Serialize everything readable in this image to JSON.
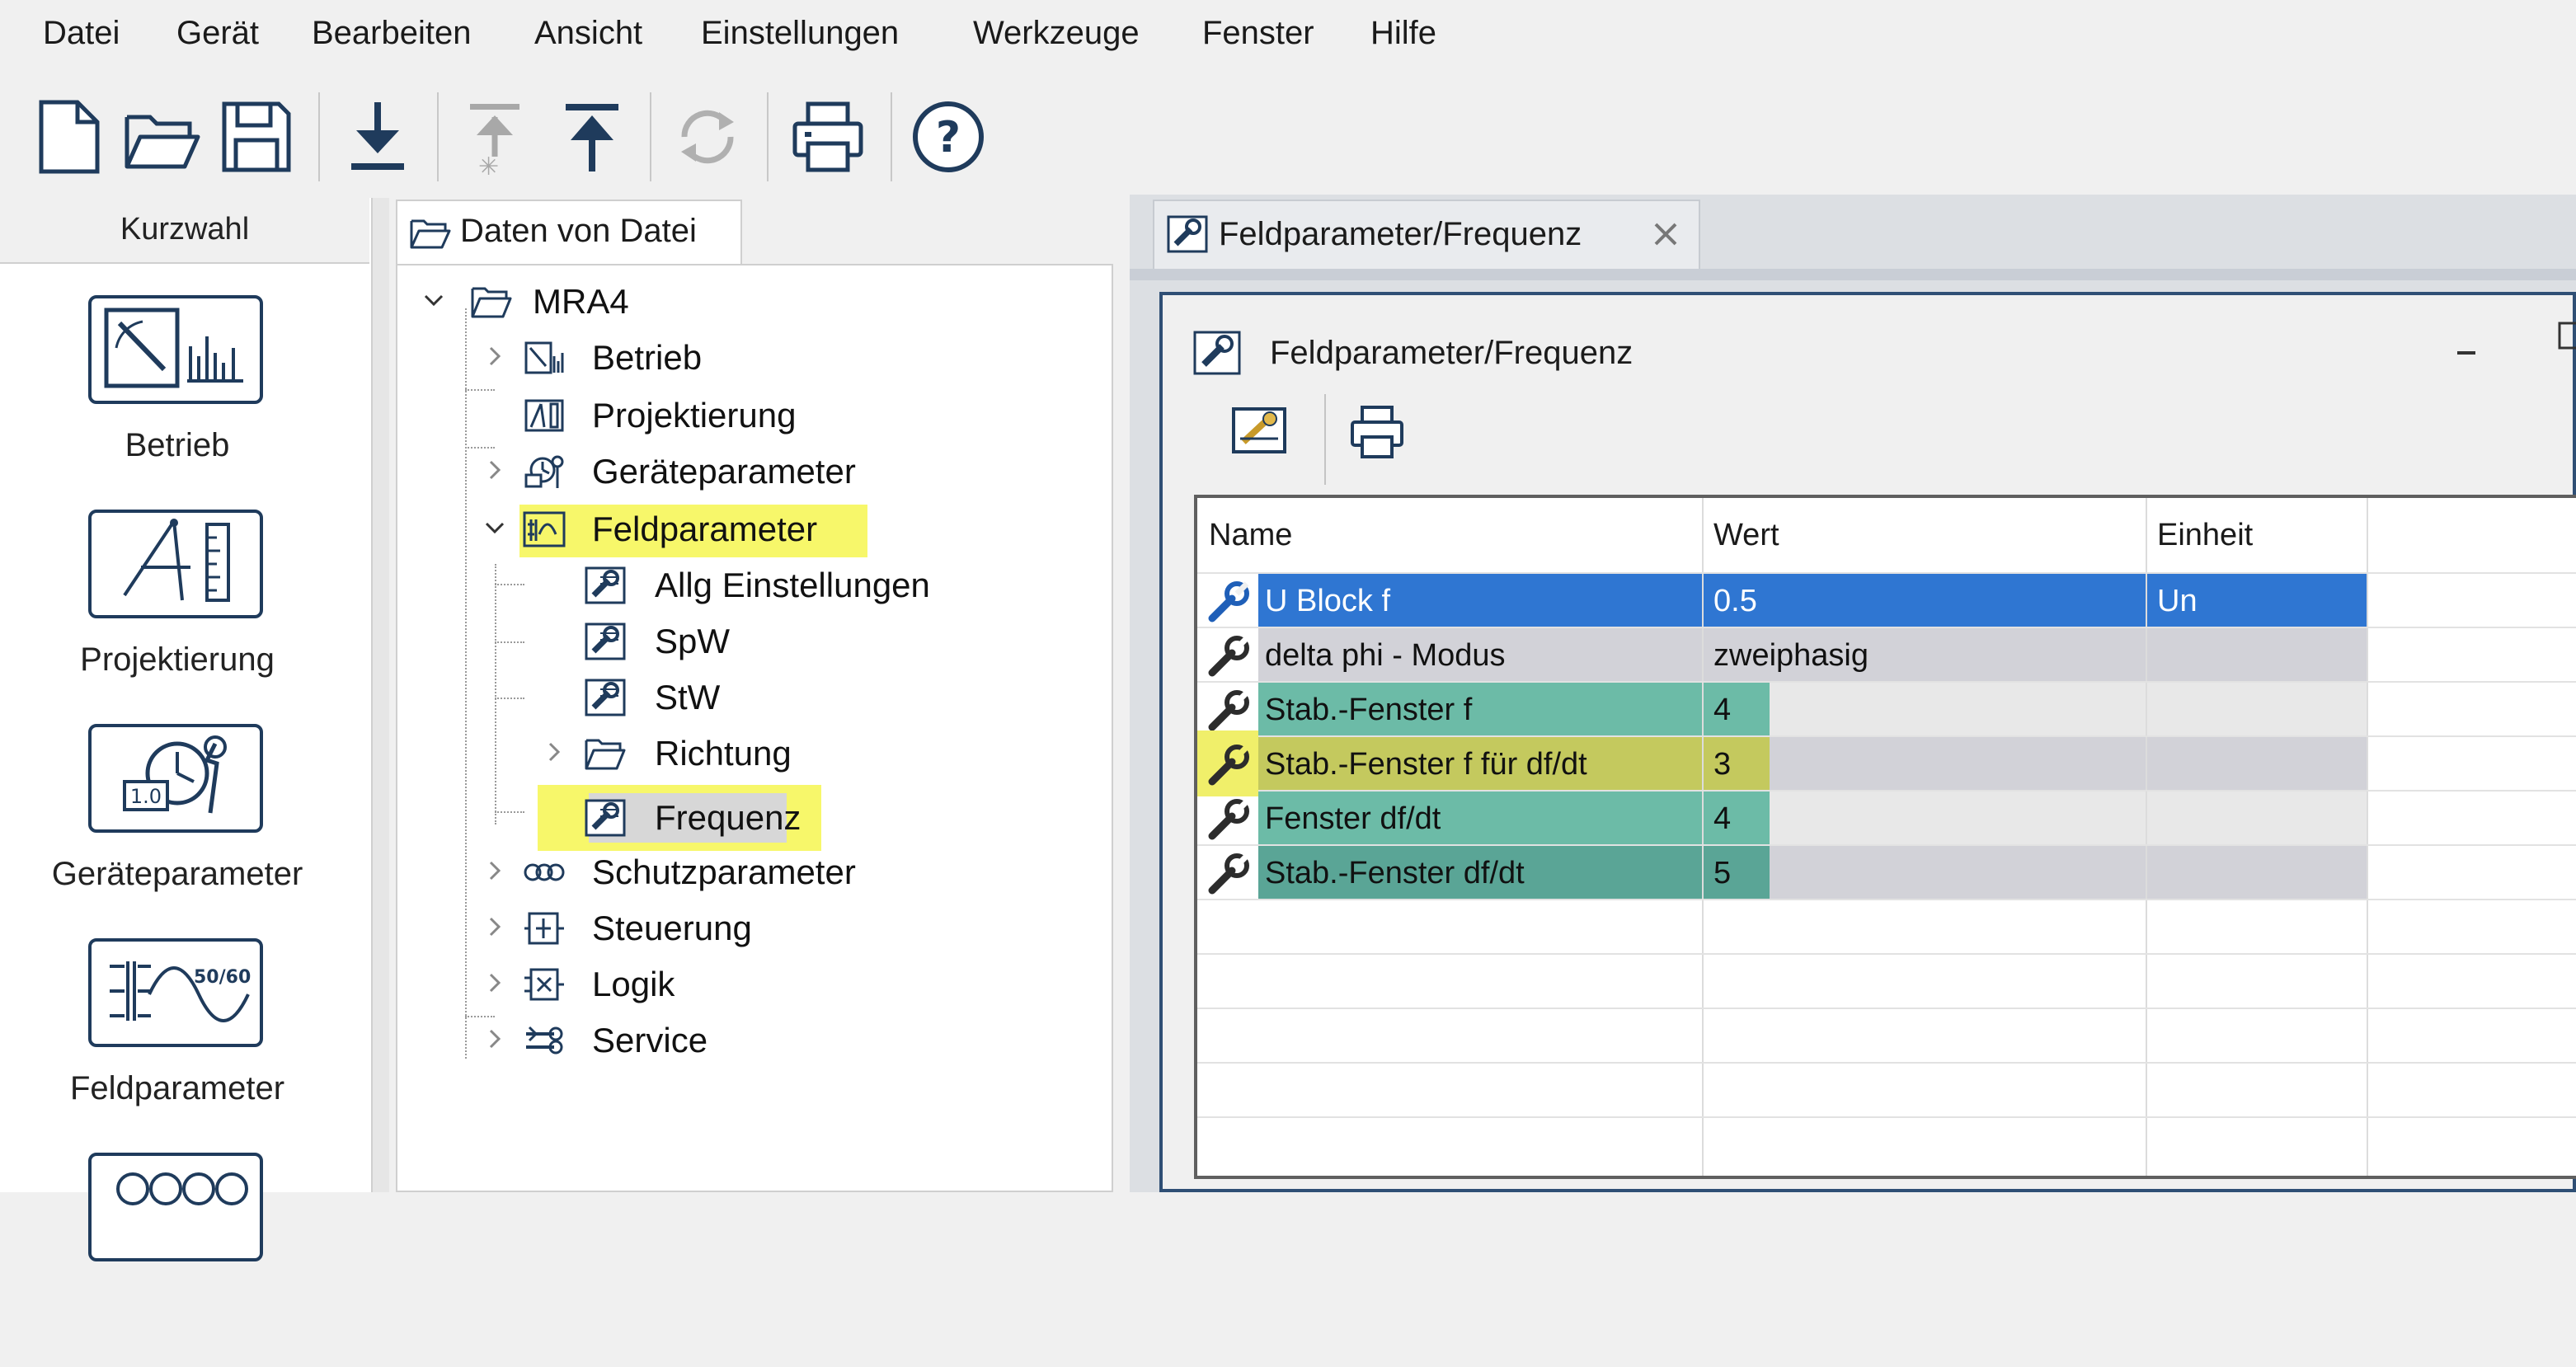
{
  "menu": [
    "Datei",
    "Gerät",
    "Bearbeiten",
    "Ansicht",
    "Einstellungen",
    "Werkzeuge",
    "Fenster",
    "Hilfe"
  ],
  "toolbar": {
    "buttons": [
      "new-file-icon",
      "open-folder-icon",
      "save-icon",
      "download-icon",
      "upload-disabled-icon",
      "upload-icon",
      "refresh-disabled-icon",
      "print-icon",
      "help-icon"
    ]
  },
  "kurzwahl": {
    "header": "Kurzwahl",
    "items": [
      "Betrieb",
      "Projektierung",
      "Geräteparameter",
      "Feldparameter"
    ]
  },
  "tree": {
    "tab_label": "Daten von Datei",
    "root": "MRA4",
    "items": [
      "Betrieb",
      "Projektierung",
      "Geräteparameter",
      "Feldparameter",
      "Allg Einstellungen",
      "SpW",
      "StW",
      "Richtung",
      "Frequenz",
      "Schutzparameter",
      "Steuerung",
      "Logik",
      "Service"
    ],
    "selected": "Frequenz",
    "highlight_color": "#f7f76a"
  },
  "document": {
    "tab_label": "Feldparameter/Frequenz",
    "window_title": "Feldparameter/Frequenz",
    "columns": [
      "Name",
      "Wert",
      "Einheit"
    ],
    "rows": [
      {
        "name": "U Block f",
        "value": "0.5",
        "unit": "Un"
      },
      {
        "name": "delta phi - Modus",
        "value": "zweiphasig",
        "unit": ""
      },
      {
        "name": "Stab.-Fenster f",
        "value": "4",
        "unit": ""
      },
      {
        "name": "Stab.-Fenster f für df/dt",
        "value": "3",
        "unit": ""
      },
      {
        "name": "Fenster df/dt",
        "value": "4",
        "unit": ""
      },
      {
        "name": "Stab.-Fenster df/dt",
        "value": "5",
        "unit": ""
      }
    ],
    "selected_row_color": "#2f76d2",
    "teal_highlight_color": "#5fb5a3",
    "yellow_highlight_color": "#dcdc4a"
  }
}
